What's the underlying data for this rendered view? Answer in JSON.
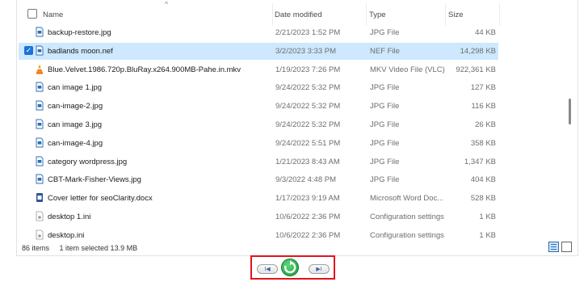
{
  "header": {
    "name": "Name",
    "date": "Date modified",
    "type": "Type",
    "size": "Size"
  },
  "files": [
    {
      "name": "backup-restore.jpg",
      "date": "2/21/2023 1:52 PM",
      "type": "JPG File",
      "size": "44 KB",
      "icon": "image-file-icon"
    },
    {
      "name": "badlands moon.nef",
      "date": "3/2/2023 3:33 PM",
      "type": "NEF File",
      "size": "14,298 KB",
      "icon": "image-file-icon",
      "selected": true
    },
    {
      "name": "Blue.Velvet.1986.720p.BluRay.x264.900MB-Pahe.in.mkv",
      "date": "1/19/2023 7:26 PM",
      "type": "MKV Video File (VLC)",
      "size": "922,361 KB",
      "icon": "vlc-cone-icon"
    },
    {
      "name": "can image 1.jpg",
      "date": "9/24/2022 5:32 PM",
      "type": "JPG File",
      "size": "127 KB",
      "icon": "image-file-icon"
    },
    {
      "name": "can-image-2.jpg",
      "date": "9/24/2022 5:32 PM",
      "type": "JPG File",
      "size": "116 KB",
      "icon": "image-file-icon"
    },
    {
      "name": "can image 3.jpg",
      "date": "9/24/2022 5:32 PM",
      "type": "JPG File",
      "size": "26 KB",
      "icon": "image-file-icon"
    },
    {
      "name": "can-image-4.jpg",
      "date": "9/24/2022 5:51 PM",
      "type": "JPG File",
      "size": "358 KB",
      "icon": "image-file-icon"
    },
    {
      "name": "category wordpress.jpg",
      "date": "1/21/2023 8:43 AM",
      "type": "JPG File",
      "size": "1,347 KB",
      "icon": "image-file-icon"
    },
    {
      "name": "CBT-Mark-Fisher-Views.jpg",
      "date": "9/3/2022 4:48 PM",
      "type": "JPG File",
      "size": "404 KB",
      "icon": "image-file-icon"
    },
    {
      "name": "Cover letter for seoClarity.docx",
      "date": "1/17/2023 9:19 AM",
      "type": "Microsoft Word Doc...",
      "size": "528 KB",
      "icon": "word-doc-icon"
    },
    {
      "name": "desktop 1.ini",
      "date": "10/6/2022 2:36 PM",
      "type": "Configuration settings",
      "size": "1 KB",
      "icon": "settings-file-icon"
    },
    {
      "name": "desktop.ini",
      "date": "10/6/2022 2:36 PM",
      "type": "Configuration settings",
      "size": "1 KB",
      "icon": "settings-file-icon"
    }
  ],
  "status": {
    "item_count": "86 items",
    "selection": "1 item selected  13.9 MB"
  },
  "player": {
    "prev_glyph": "I◀",
    "next_glyph": "▶I"
  },
  "colors": {
    "selected_row": "#cde8ff",
    "checkbox": "#1a73d6",
    "highlight_border": "#e0141e",
    "replay_button": "#139a3a"
  }
}
